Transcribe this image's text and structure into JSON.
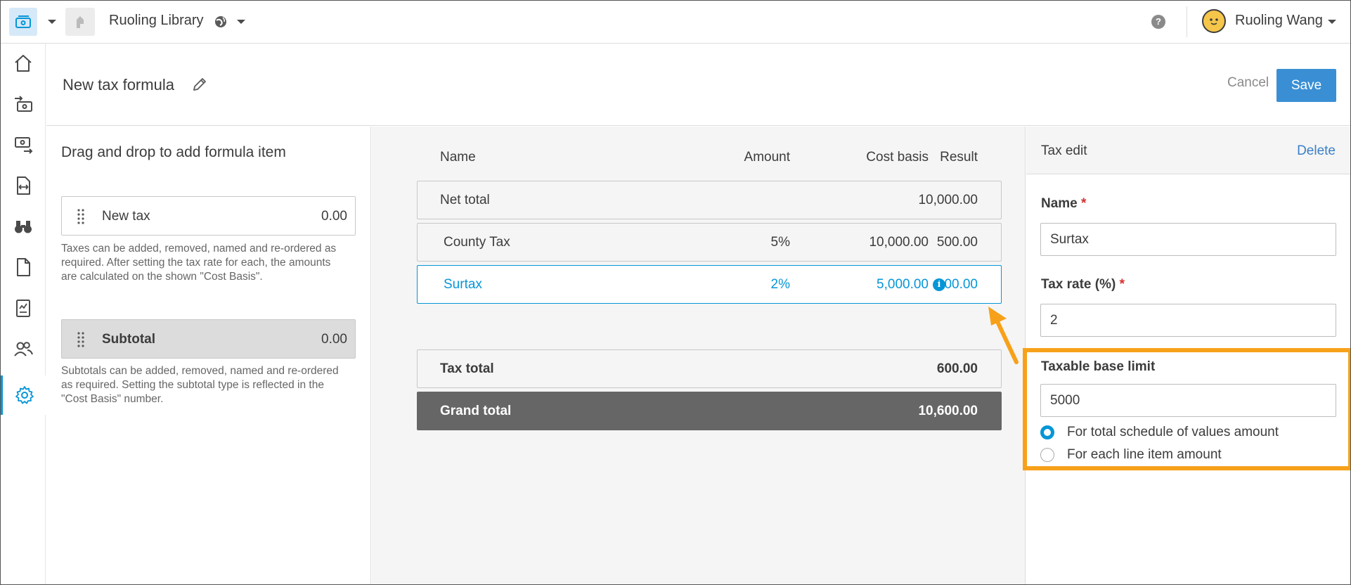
{
  "topbar": {
    "project_name": "Ruoling Library",
    "help_glyph": "?",
    "user_name": "Ruoling Wang"
  },
  "rail": {
    "items": [
      "home-icon",
      "incoming-payments-icon",
      "outgoing-payments-icon",
      "change-orders-icon",
      "binoculars-icon",
      "document-icon",
      "report-icon",
      "people-icon",
      "settings-icon"
    ],
    "active_item": "settings-icon"
  },
  "header": {
    "title": "New tax formula",
    "cancel_label": "Cancel",
    "save_label": "Save"
  },
  "palette": {
    "heading": "Drag and drop to add formula item",
    "tax_item": {
      "label": "New tax",
      "value": "0.00",
      "description": "Taxes can be added, removed, named and re-ordered as required. After setting the tax rate for each, the amounts are calculated on the shown \"Cost Basis\"."
    },
    "subtotal_item": {
      "label": "Subtotal",
      "value": "0.00",
      "description": "Subtotals can be added, removed, named and re-ordered as required. Setting the subtotal type is reflected in the \"Cost Basis\" number."
    }
  },
  "formula": {
    "columns": {
      "name": "Name",
      "amount": "Amount",
      "cost_basis": "Cost basis",
      "result": "Result"
    },
    "net_total": {
      "name": "Net total",
      "result": "10,000.00"
    },
    "rows": [
      {
        "name": "County Tax",
        "amount": "5%",
        "cost_basis": "10,000.00",
        "result": "500.00"
      },
      {
        "name": "Surtax",
        "amount": "2%",
        "cost_basis": "5,000.00",
        "result": "100.00"
      }
    ],
    "info_glyph": "i",
    "tax_total": {
      "name": "Tax total",
      "result": "600.00"
    },
    "grand_total": {
      "name": "Grand total",
      "result": "10,600.00"
    }
  },
  "tax_edit": {
    "title": "Tax edit",
    "delete_label": "Delete",
    "name_label": "Name",
    "name_value": "Surtax",
    "rate_label": "Tax rate (%)",
    "rate_value": "2",
    "required_mark": "*",
    "limit_label": "Taxable base limit",
    "limit_value": "5000",
    "limit_options": [
      "For total schedule of values amount",
      "For each line item amount"
    ],
    "limit_selected": "For total schedule of values amount"
  },
  "colors": {
    "accent": "#0696d7",
    "save": "#3a8fd4",
    "callout": "#f7a11a",
    "grand_total_bg": "#666666"
  }
}
